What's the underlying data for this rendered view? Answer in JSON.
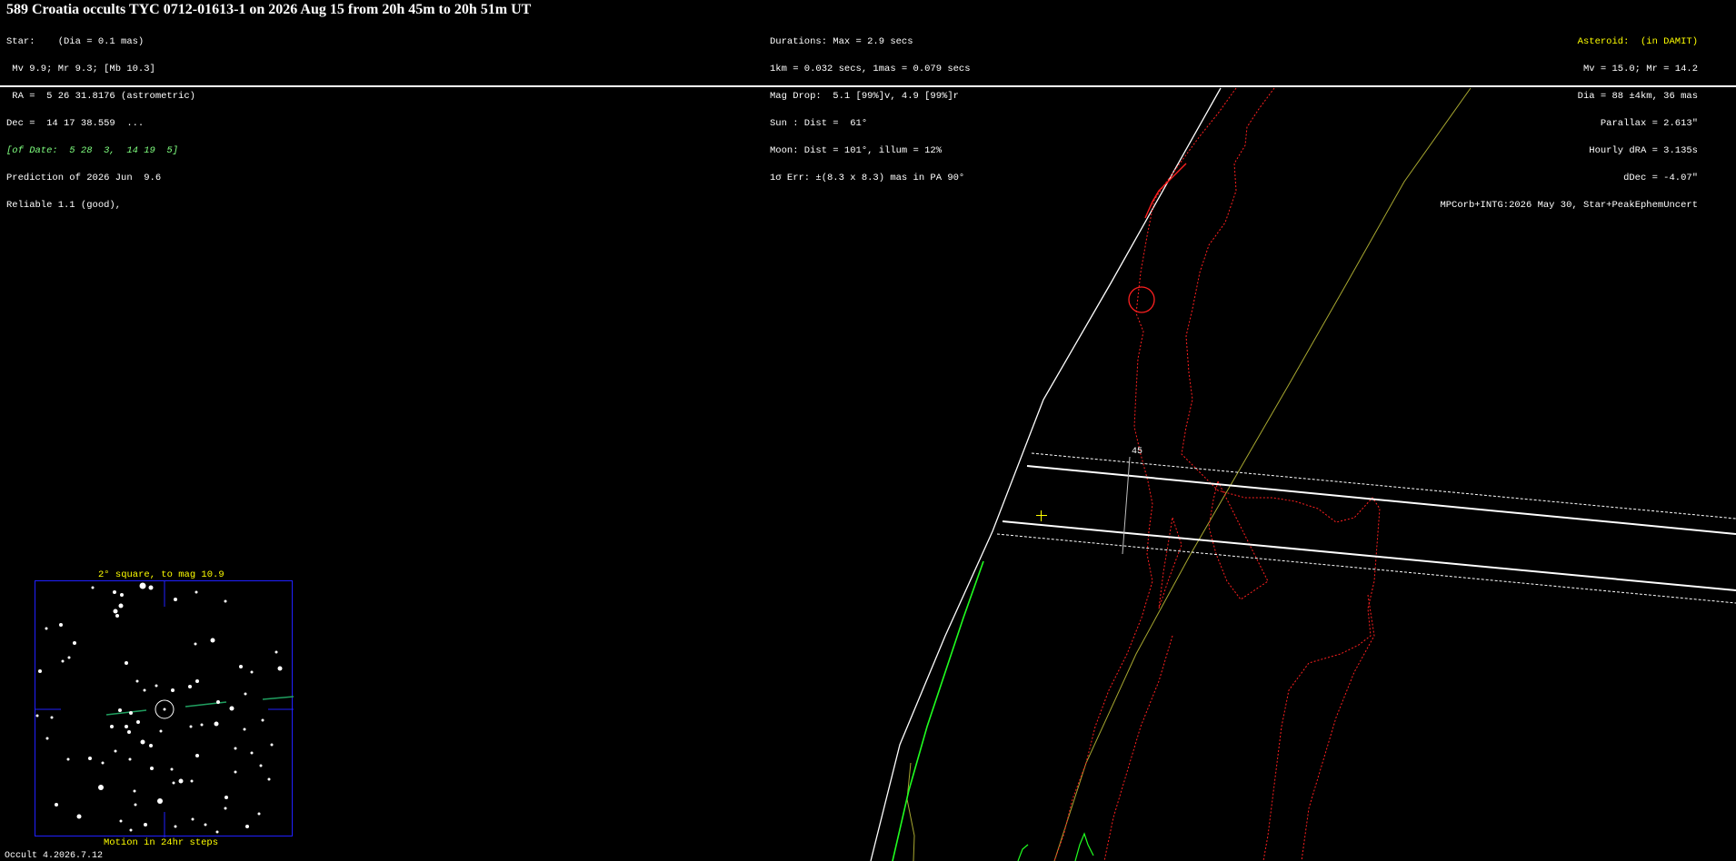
{
  "title": "589 Croatia occults TYC 0712-01613-1 on 2026 Aug 15 from 20h 45m to 20h 51m UT",
  "star_block": {
    "line1": "Star:    (Dia = 0.1 mas)",
    "line2": " Mv 9.9; Mr 9.3; [Mb 10.3]",
    "line3": " RA =  5 26 31.8176 (astrometric)",
    "line4": "Dec =  14 17 38.559  ...",
    "line5": "[of Date:  5 28  3,  14 19  5]",
    "line6": "Prediction of 2026 Jun  9.6",
    "line7": "Reliable 1.1 (good),"
  },
  "mid_block": {
    "line1": "Durations: Max = 2.9 secs",
    "line2": "1km = 0.032 secs, 1mas = 0.079 secs",
    "line3": "Mag Drop:  5.1 [99%]v, 4.9 [99%]r",
    "line4": "Sun : Dist =  61°",
    "line5": "Moon: Dist = 101°, illum = 12%",
    "line6": "1σ Err: ±(8.3 x 8.3) mas in PA 90°"
  },
  "right_block": {
    "line1": "Asteroid:  (in DAMIT)",
    "line2": "Mv = 15.0; Mr = 14.2",
    "line3": "Dia = 88 ±4km, 36 mas",
    "line4": "Parallax = 2.613\"",
    "line5": "Hourly dRA = 3.135s",
    "line6": "dDec = -4.07\"",
    "line7": "MPCorb+INTG:2026 May 30, Star+PeakEphemUncert"
  },
  "plot": {
    "time_tick_label": "45"
  },
  "finder": {
    "title": "2° square, to mag 10.9",
    "caption": "Motion in 24hr steps"
  },
  "footer": "Occult 4.2026.7.12",
  "colors": {
    "background": "#000000",
    "coastline": "#ff2020",
    "path_lines": "#ffffff",
    "earth_limb": "#ffffff",
    "sunset_line": "#a8a830",
    "green_coast": "#20ff20",
    "finder_border": "#2020ff",
    "motion_track": "#20a060",
    "highlight": "#ffff00"
  }
}
